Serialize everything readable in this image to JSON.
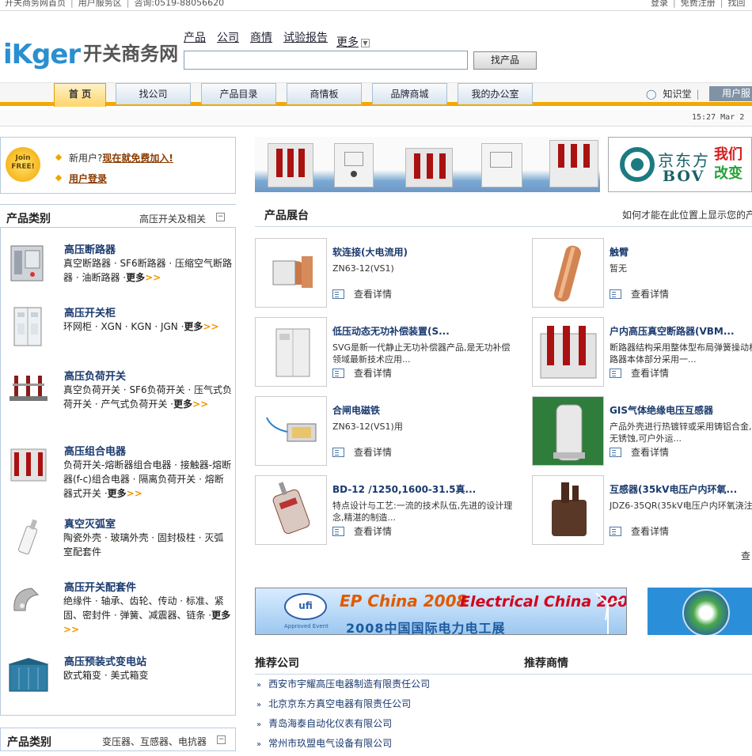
{
  "topbar": {
    "links": [
      "开关商务网首页",
      "用户服务区"
    ],
    "phone": "咨询:0519-88056620",
    "right_links": [
      "登录",
      "免费注册",
      "找回"
    ]
  },
  "logo": {
    "en": "iKger",
    "cn": "开关商务网"
  },
  "search": {
    "tabs": [
      "产品",
      "公司",
      "商情",
      "试验报告"
    ],
    "more": "更多",
    "button": "找产品",
    "value": ""
  },
  "nav": {
    "tabs": [
      "首 页",
      "找公司",
      "产品目录",
      "商情板",
      "品牌商城",
      "我的办公室"
    ],
    "active": "首 页",
    "knowledge": "知识堂",
    "user_button": "用户服"
  },
  "timebar": {
    "time": "15:27  Mar  2"
  },
  "join": {
    "badge": "Join FREE!",
    "new_user_prefix": "新用户?",
    "new_user_link": "现在就免费加入!",
    "login": "用户登录"
  },
  "category_panel": {
    "title": "产品类别",
    "subtitle": "高压开关及相关",
    "items": [
      {
        "title": "高压断路器",
        "links": "真空断路器 · SF6断路器 · 压缩空气断路器 · 油断路器 ·",
        "more": "更多",
        "arrow": ">>"
      },
      {
        "title": "高压开关柜",
        "links": "环网柜 · XGN · KGN · JGN ·",
        "more": "更多",
        "arrow": ">>"
      },
      {
        "title": "高压负荷开关",
        "links": "真空负荷开关 · SF6负荷开关 · 压气式负荷开关 · 产气式负荷开关 ·",
        "more": "更多",
        "arrow": ">>"
      },
      {
        "title": "高压组合电器",
        "links": "负荷开关-熔断器组合电器 · 接触器-熔断器(f-c)组合电器 · 隔离负荷开关 · 熔断器式开关 ·",
        "more": "更多",
        "arrow": ">>"
      },
      {
        "title": "真空灭弧室",
        "links": "陶瓷外壳 · 玻璃外壳 · 固封极柱 · 灭弧室配套件",
        "more": "",
        "arrow": ""
      },
      {
        "title": "高压开关配套件",
        "links": "绝缘件 · 轴承、齿轮、传动 · 标准、紧固、密封件 · 弹簧、减震器、链条 ·",
        "more": "更多",
        "arrow": ">>"
      },
      {
        "title": "高压预装式变电站",
        "links": "欧式箱变 · 美式箱变",
        "more": "",
        "arrow": ""
      }
    ]
  },
  "category_panel2": {
    "title": "产品类别",
    "subtitle": "变压器、互感器、电抗器"
  },
  "banner_bov": {
    "cn": "京东方",
    "en": "BOV",
    "slogan1": "我们",
    "slogan1b": "用",
    "slogan2": "改变"
  },
  "products": {
    "title": "产品展台",
    "hint": "如何才能在此位置上显示您的产",
    "detail_label": "查看详情",
    "items": [
      {
        "title": "软连接(大电流用)",
        "desc": "ZN63-12(VS1)"
      },
      {
        "title": "触臂",
        "desc": "暂无"
      },
      {
        "title": "低压动态无功补偿装置(S...",
        "desc": "SVG是新一代静止无功补偿器产品,是无功补偿领域最新技术应用..."
      },
      {
        "title": "户内高压真空断路器(VBM...",
        "desc": "断路器结构采用整体型布局弹簧操动机构与断路器本体部分采用一..."
      },
      {
        "title": "合闸电磁铁",
        "desc": "ZN63-12(VS1)用"
      },
      {
        "title": "GIS气体绝缘电压互感器",
        "desc": "产品外壳进行热镀锌或采用铸铝合金,长期运行无锈蚀,可户外运..."
      },
      {
        "title": "BD-12 /1250,1600-31.5真...",
        "desc": "特点设计与工艺:一流的技术队伍,先进的设计理念,精湛的制造..."
      },
      {
        "title": "互感器(35kV电压户内环氧...",
        "desc": "JDZ6-35QR(35kV电压户内环氧浇注"
      }
    ],
    "see_more": "查"
  },
  "expo": {
    "ufi": "ufi",
    "ufi_sub": "Approved Event",
    "ep": "EP China 2008",
    "ec": "Electrical China 2008",
    "cn": "2008中国国际电力电工展"
  },
  "recommend": {
    "companies_title": "推荐公司",
    "news_title": "推荐商情",
    "companies": [
      "西安市宇耀高压电器制造有限责任公司",
      "北京京东方真空电器有限责任公司",
      "青岛海泰自动化仪表有限公司",
      "常州市玖盟电气设备有限公司"
    ]
  }
}
